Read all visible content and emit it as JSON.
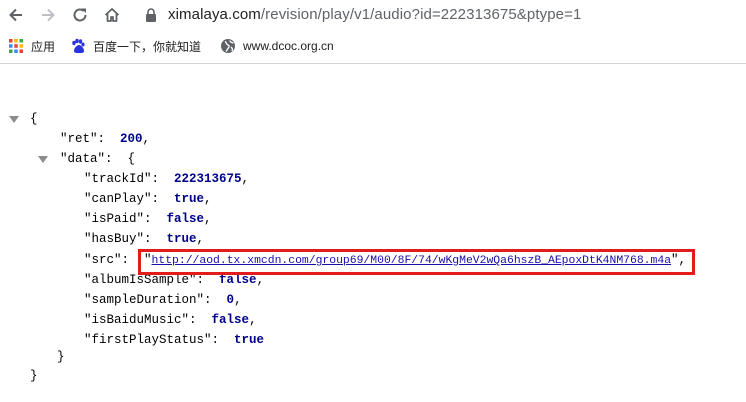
{
  "browser": {
    "url_host": "ximalaya.com",
    "url_path": "/revision/play/v1/audio?id=222313675&ptype=1"
  },
  "bookmarks": {
    "apps_label": "应用",
    "baidu_label": "百度一下，你就知道",
    "dcoc_label": "www.dcoc.org.cn"
  },
  "json": {
    "open_brace": "{",
    "close_brace": "}",
    "ret_key": "\"ret\"",
    "ret_value": "200",
    "data_key": "\"data\"",
    "data_open": "{",
    "data_close": "}",
    "fields": {
      "trackId_key": "\"trackId\"",
      "trackId_value": "222313675",
      "canPlay_key": "\"canPlay\"",
      "canPlay_value": "true",
      "isPaid_key": "\"isPaid\"",
      "isPaid_value": "false",
      "hasBuy_key": "\"hasBuy\"",
      "hasBuy_value": "true",
      "src_key": "\"src\"",
      "src_value": "http://aod.tx.xmcdn.com/group69/M00/8F/74/wKgMeV2wQa6hszB_AEpoxDtK4NM768.m4a",
      "albumIsSample_key": "\"albumIsSample\"",
      "albumIsSample_value": "false",
      "sampleDuration_key": "\"sampleDuration\"",
      "sampleDuration_value": "0",
      "isBaiduMusic_key": "\"isBaiduMusic\"",
      "isBaiduMusic_value": "false",
      "firstPlayStatus_key": "\"firstPlayStatus\"",
      "firstPlayStatus_value": "true"
    }
  },
  "colors": {
    "highlight_box": "#e31b1b",
    "json_value": "#00008b",
    "link": "#1a0dab"
  }
}
